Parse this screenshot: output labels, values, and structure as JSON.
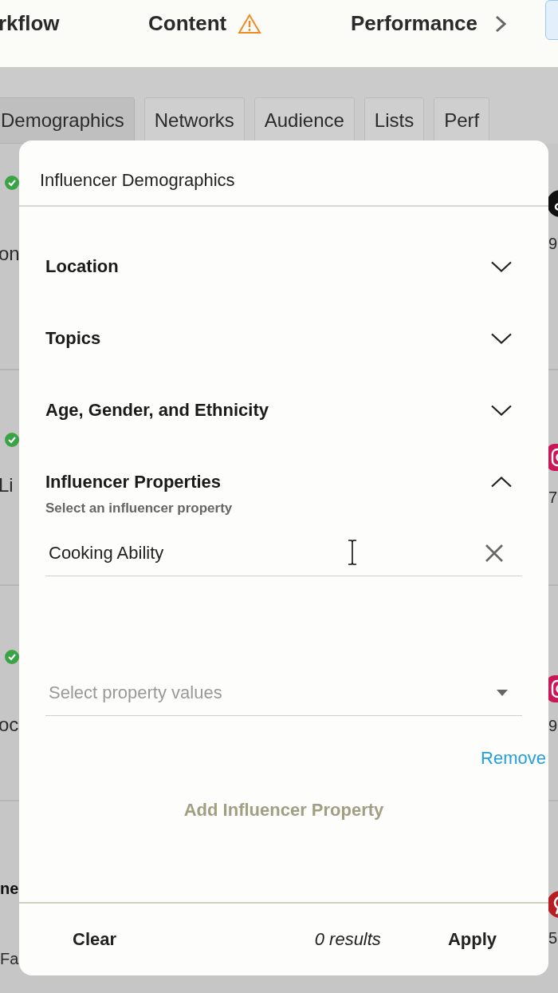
{
  "nav": {
    "items": [
      {
        "label": "rkflow",
        "warning": false,
        "chevron": false
      },
      {
        "label": "Content",
        "warning": true,
        "chevron": false
      },
      {
        "label": "Performance",
        "warning": false,
        "chevron": true
      }
    ]
  },
  "tabs": [
    {
      "label": "Demographics",
      "selected": true
    },
    {
      "label": "Networks",
      "selected": false
    },
    {
      "label": "Audience",
      "selected": false
    },
    {
      "label": "Lists",
      "selected": false
    },
    {
      "label": "Perf",
      "selected": false
    }
  ],
  "background_rows": [
    {
      "left_text": "on",
      "verified": true,
      "kind": "tiktok",
      "right_text": "9"
    },
    {
      "left_text": "Li",
      "verified": true,
      "kind": "instagram",
      "right_text": "7"
    },
    {
      "left_text": "oc",
      "verified": true,
      "kind": "instagram",
      "right_text": "9"
    },
    {
      "left_title": "ne",
      "left_text": "Fa",
      "verified": false,
      "kind": "pinterest",
      "right_text": "5"
    }
  ],
  "modal": {
    "title": "Influencer Demographics",
    "sections": [
      {
        "title": "Location",
        "expanded": false
      },
      {
        "title": "Topics",
        "expanded": false
      },
      {
        "title": "Age, Gender, and Ethnicity",
        "expanded": false
      },
      {
        "title": "Influencer Properties",
        "expanded": true,
        "hint": "Select an influencer property",
        "property_field": {
          "value": "Cooking Ability"
        },
        "values_field": {
          "placeholder": "Select property values"
        },
        "remove_link": "Remove",
        "add_button": {
          "label": "Add Influencer Property",
          "disabled": true
        }
      }
    ],
    "footer": {
      "clear": "Clear",
      "results": "0 results",
      "apply": "Apply"
    }
  }
}
